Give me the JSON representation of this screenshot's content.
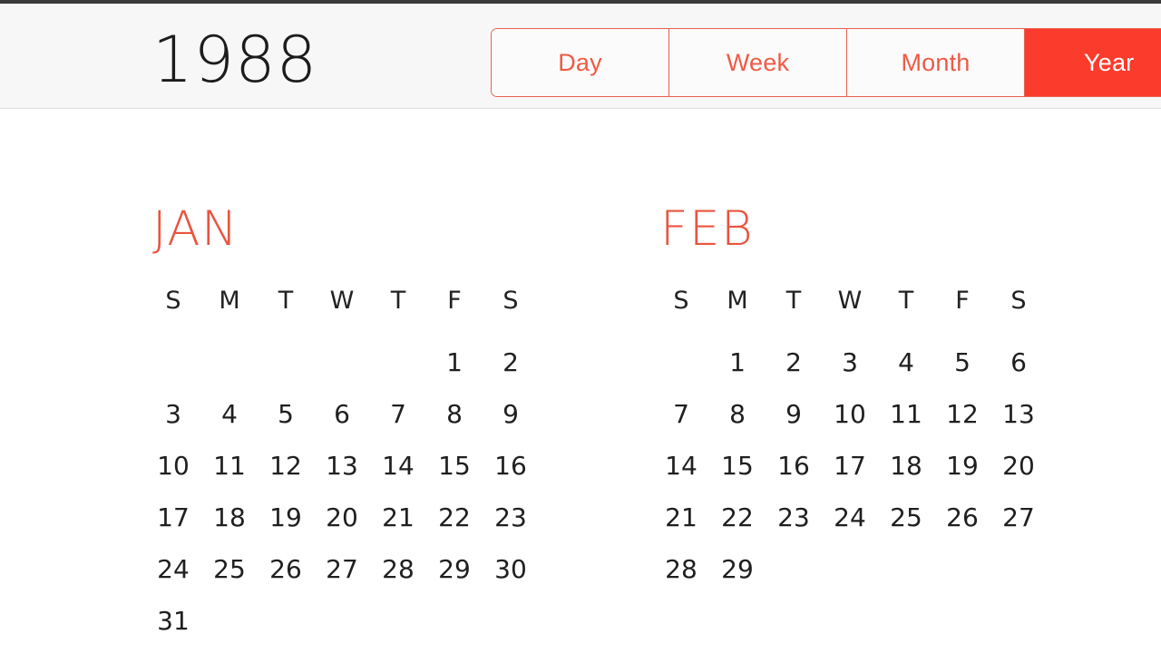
{
  "window": {
    "accent_color": "#fb3b2b",
    "accent_soft_color": "#ef5a46",
    "month_label_color": "#e8543f",
    "toolbar_bg": "#f7f7f7",
    "body_bg": "#ffffff",
    "day_text_color": "#1f1f1f"
  },
  "toolbar": {
    "year_title": "1988",
    "view_switcher": {
      "selected": "Year",
      "options": [
        {
          "label": "Day",
          "selected": false
        },
        {
          "label": "Week",
          "selected": false
        },
        {
          "label": "Month",
          "selected": false
        },
        {
          "label": "Year",
          "selected": true
        }
      ]
    }
  },
  "calendar": {
    "year": "1988",
    "weekday_headers": [
      "S",
      "M",
      "T",
      "W",
      "T",
      "F",
      "S"
    ],
    "months": [
      {
        "name": "JAN",
        "full_name": "January",
        "lead_blanks": 5,
        "num_days": 31,
        "weeks": [
          [
            "",
            "",
            "",
            "",
            "",
            "1",
            "2"
          ],
          [
            "3",
            "4",
            "5",
            "6",
            "7",
            "8",
            "9"
          ],
          [
            "10",
            "11",
            "12",
            "13",
            "14",
            "15",
            "16"
          ],
          [
            "17",
            "18",
            "19",
            "20",
            "21",
            "22",
            "23"
          ],
          [
            "24",
            "25",
            "26",
            "27",
            "28",
            "29",
            "30"
          ],
          [
            "31",
            "",
            "",
            "",
            "",
            "",
            ""
          ]
        ]
      },
      {
        "name": "FEB",
        "full_name": "February",
        "lead_blanks": 1,
        "num_days": 29,
        "weeks": [
          [
            "",
            "1",
            "2",
            "3",
            "4",
            "5",
            "6"
          ],
          [
            "7",
            "8",
            "9",
            "10",
            "11",
            "12",
            "13"
          ],
          [
            "14",
            "15",
            "16",
            "17",
            "18",
            "19",
            "20"
          ],
          [
            "21",
            "22",
            "23",
            "24",
            "25",
            "26",
            "27"
          ],
          [
            "28",
            "29",
            "",
            "",
            "",
            "",
            ""
          ]
        ]
      }
    ]
  }
}
